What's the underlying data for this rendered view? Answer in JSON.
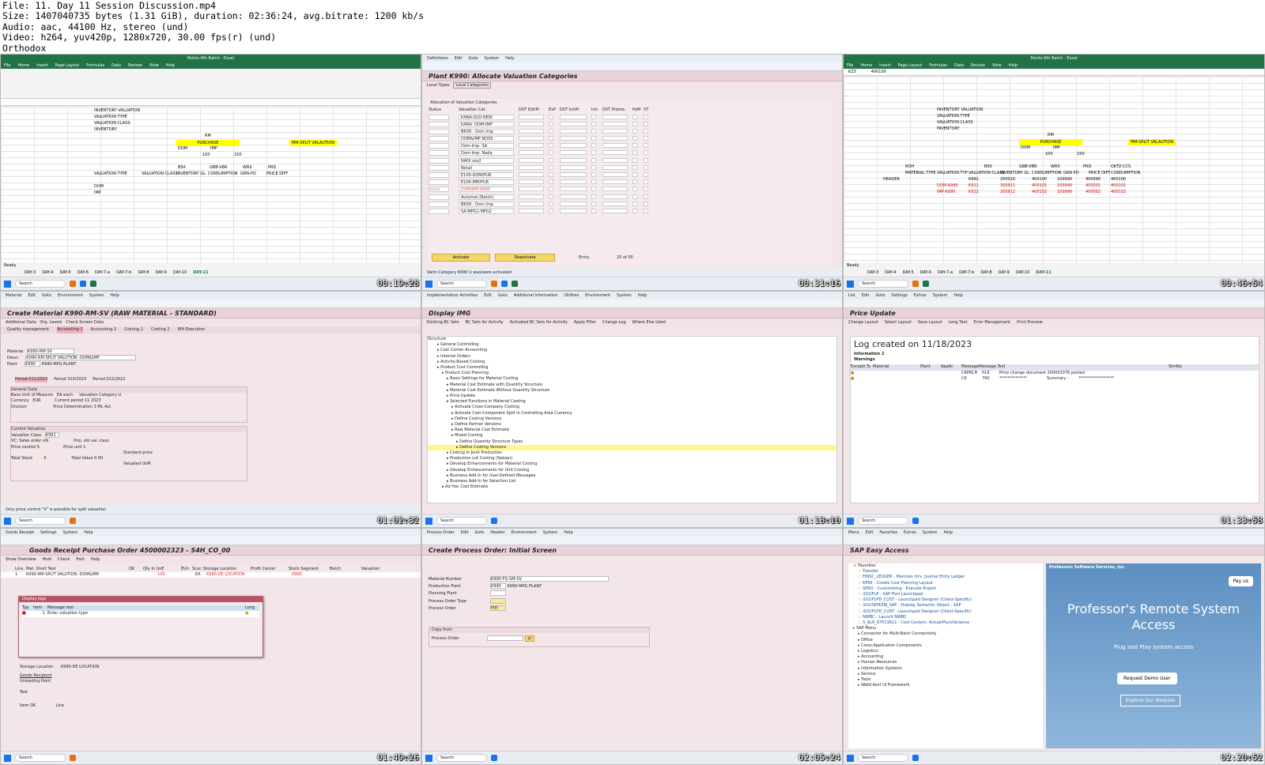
{
  "header": {
    "file": "File: 11. Day 11 Session Discussion.mp4",
    "size": "Size: 1407040735 bytes (1.31 GiB), duration: 02:36:24, avg.bitrate: 1200 kb/s",
    "audio": "Audio: aac, 44100 Hz, stereo (und)",
    "video": "Video: h264, yuv420p, 1280x720, 30.00 fps(r) (und)",
    "author": "Orthodox"
  },
  "frames": {
    "f1": {
      "ts": "00:19:28",
      "window_title": "Points-9th Batch - Excel",
      "tabs": [
        "File",
        "Home",
        "Insert",
        "Page Layout",
        "Formulas",
        "Data",
        "Review",
        "View",
        "Help"
      ],
      "labels": [
        "INVENTORY VALUATION",
        "VALUATION TYPE",
        "VALUATION CLASS",
        "INVENTORY",
        "RM",
        "PURCHASE",
        "MM-SPLIT VALAUTION",
        "DOM",
        "IMP",
        "100",
        "150",
        "BSX",
        "GBB-VBR",
        "WRX",
        "PRD",
        "VALUATION TYPE",
        "VALUATION CLASS",
        "INVENTORY GL",
        "CONSUMPTION",
        "GRN-PO",
        "PRICE DIFF",
        "DOM",
        "IMP"
      ],
      "sheets": [
        "DAY-3",
        "DAY-4",
        "DAY-5",
        "DAY-6",
        "DAY-7-a",
        "DAY-7-b",
        "DAY-8",
        "DAY-9",
        "DAY-10",
        "DAY-11"
      ]
    },
    "f2": {
      "ts": "00:31:16",
      "menu": [
        "Definitions",
        "Edit",
        "Goto",
        "System",
        "Help"
      ],
      "title": "Plant K990: Allocate Valuation Categories",
      "app": [
        "Local Types",
        "Local Categories"
      ],
      "section": "Allocation of Valuation Categories",
      "cols": [
        "Status",
        "Valuation Cat.",
        "DVT EditPr",
        "ExP",
        "DVT InhPr",
        "Inh",
        "DVT Promo.",
        "PoM",
        "VT"
      ],
      "rows": [
        "KANA-OLD-NEW",
        "KANA- DOM-IMP",
        "BK09 - Dom Imp",
        "DOM&IMP NOSS",
        "Dom-Imp- SA",
        "Dom-Imp- Nada",
        "NADI sce2",
        "Retail",
        "E100-DOM/PUR",
        "E100-IMP/PUR",
        "DOM/IMP-K990",
        "Automat.(Batch)",
        "BK09 - Dom Imp",
        "SA-MPG1-MPG2"
      ],
      "activate": "Activate",
      "deactivate": "Deactivate",
      "entry": "Entry",
      "entry_val": "25 of  50",
      "status": "Valtn Category K990 U was/were activated",
      "active": "Active"
    },
    "f3": {
      "ts": "00:46:54",
      "window_title": "Points-9th Batch - Excel",
      "namebox": "K23",
      "formula": "400100",
      "labels": [
        "INVENTORY VALUATION",
        "VALUATION TYPE",
        "VALUATION CLASS",
        "INVENTORY",
        "RM",
        "PURCHASE",
        "MM-SPLIT VALAUTION",
        "DOM",
        "IMP",
        "100",
        "150",
        "ROH",
        "BSX",
        "GBB-VBR",
        "WRX",
        "PRD",
        "OKTZ-CCS",
        "MATERIAL TYPE",
        "VALUATION TYP",
        "VALUATION CLASS",
        "INVENTORY GL",
        "CONSUMPTION",
        "GRN PO",
        "PRICE DIFF",
        "CONSUMPTION",
        "HEADER",
        "K991",
        "200010",
        "400100",
        "100990",
        "400990",
        "400100",
        "DOM-K990",
        "K911",
        "200911",
        "400101",
        "100990",
        "400001",
        "400101",
        "IMP-K990",
        "K912",
        "200912",
        "400102",
        "100990",
        "400002",
        "400102"
      ]
    },
    "f4": {
      "ts": "01:02:32",
      "title": "Create Material K990-RM-SV (RAW MATERIAL - STANDARD)",
      "app": [
        "Additional Data",
        "Org. Levels",
        "Check Screen Data"
      ],
      "tabs": [
        "Quality management",
        "Accounting 1",
        "Accounting 2",
        "Costing 1",
        "Costing 2",
        "WH Execution"
      ],
      "material": "K990-RM-SV",
      "desc": "K990-RM-SPLIT VALUTION -DOM&IMP",
      "plant": "K990",
      "plant_name": "K990-MPG PLANT",
      "period_tabs": [
        "Period 011/2023",
        "Period 010/2023",
        "Period 012/2022"
      ],
      "gd": "General Data",
      "cv": "Current Valuation",
      "fields": {
        "bum": "Base Unit of Measure",
        "bum_v": "EA",
        "bum_t": "each",
        "cur": "Currency",
        "cur_v": "EUR",
        "div": "Division",
        "vcat": "Valuation Category",
        "vcat_v": "U",
        "cp": "Current period",
        "cp_v": "11 2023",
        "pd": "Price Determination",
        "pd_v": "3",
        "ml": "ML Act.",
        "vc": "Valuation Class",
        "vc_v": "K991",
        "vcs": "VC: Sales order stk",
        "pc": "Price control",
        "pc_v": "S",
        "pp": "Proj. stk val. class",
        "pu": "Price unit",
        "pu_v": "1",
        "sp": "Standard price",
        "ts": "Total Stock",
        "ts_v": "0",
        "tv": "Total Value",
        "tv_v": "0.00",
        "vu": "Valuated UoM"
      },
      "status": "Only price control \"V\" is possible for split valuation"
    },
    "f5": {
      "ts": "01:18:10",
      "title": "Display IMG",
      "app": [
        "Existing BC Sets",
        "BC Sets for Activity",
        "Activated BC Sets for Activity",
        "Apply Filter",
        "Change Log",
        "Where Else Used"
      ],
      "structure": "Structure",
      "tree": [
        "General Controlling",
        "Cost Center Accounting",
        "Internal Orders",
        "Activity-Based Costing",
        "Product Cost Controlling",
        "Product Cost Planning",
        "Basic Settings for Material Costing",
        "Material Cost Estimate with Quantity Structure",
        "Material Cost Estimate Without Quantity Structure",
        "Price Update",
        "Selected Functions in Material Costing",
        "Activate Cross-Company Costing",
        "Activate Cost Component Split in Controlling Area Currency",
        "Define Costing Versions",
        "Define Partner Versions",
        "Raw Material Cost Estimate",
        "Mixed Costing",
        "Define Quantity Structure Types",
        "Define Costing Versions",
        "Costing in Joint Production",
        "Production Lot Costing (Sebian)",
        "Develop Enhancements for Material Costing",
        "Develop Enhancements for Unit Costing",
        "Business Add-In for User-Defined Messages",
        "Business Add-In for Selection List",
        "Ad Hoc Cost Estimate"
      ]
    },
    "f6": {
      "ts": "01:33:58",
      "title": "Price Update",
      "app": [
        "Change Layout",
        "Select Layout",
        "Save Layout",
        "Long Text",
        "Error Management",
        "Print Preview"
      ],
      "log": "Log created on 11/18/2023",
      "info": "Information",
      "info_n": "2",
      "warn": "Warnings",
      "cols": [
        "Excepti.",
        "Ty",
        "Material",
        "Plant",
        "AppAr.",
        "Message",
        "Message Text",
        "StmNo"
      ],
      "r1": [
        "CKPRCH",
        "019",
        "Price change document 200001076 posted"
      ],
      "r2": [
        "CK",
        "790",
        "**************",
        "Summary :",
        "******************"
      ]
    },
    "f7": {
      "ts": "01:49:26",
      "title": "Goods Receipt Purchase Order 4500002323 - S4H_CO_00",
      "menu": [
        "Goods Receipt",
        "Settings",
        "System",
        "Help"
      ],
      "app": [
        "Show Overview",
        "Hold",
        "Check",
        "Post",
        "Help"
      ],
      "cols": [
        "Line",
        "Mat. Short Text",
        "OK",
        "Qty in UnE",
        "EUn",
        "SLoc",
        "Storage Location",
        "Profit Center",
        "Stock Segment",
        "Batch",
        "Valuation"
      ],
      "row": [
        "1",
        "K990-RM-SPLIT VALUTION -DOM&IMP",
        "100",
        "EA",
        "K990-DE LOCATION",
        "K990"
      ],
      "dlg": "Display logs",
      "dlg_cols": [
        "Typ",
        "Item",
        "Message text",
        "Long"
      ],
      "dlg_row": [
        "1",
        "Enter valuation type"
      ],
      "fields": [
        "Goods Recipient",
        "Unloading Point",
        "Text",
        "Storage Location",
        "K990-DE LOCATION",
        "Item OK",
        "Line"
      ]
    },
    "f8": {
      "ts": "02:05:24",
      "title": "Create Process Order: Initial Screen",
      "menu": [
        "Process Order",
        "Edit",
        "Goto",
        "Header",
        "Environment",
        "System",
        "Help"
      ],
      "f": [
        "Material Number",
        "Production Plant",
        "Planning Plant",
        "Process Order Type",
        "Process Order"
      ],
      "v": [
        "K990-FG-SM-SV",
        "K990",
        "K990-MPG PLANT",
        "",
        "FIPI"
      ],
      "copy": "Copy from",
      "po": "Process Order"
    },
    "f9": {
      "ts": "02:20:52",
      "title": "SAP Easy Access",
      "menu": [
        "Menu",
        "Edit",
        "Favorites",
        "Extras",
        "System",
        "Help"
      ],
      "tree": [
        "Favorites",
        "Transfer",
        "FINSC_LEDGER - Maintain Unv. Journal Entry Ledger",
        "KP65 - Create Cost Planning Layout",
        "SPRO - Customizing - Execute Project",
        "/UI2/FLP - SAP Fiori Launchpad",
        "/UI2/FLPD_CUST - Launchpad Designer (Client-Specific)",
        "/UI2/SEMOBJ_SAP - Display Semantic Object - SAP",
        "/UI2/FLPD_CUST - Launchpad Designer (Client-Specific)",
        "NWBC - Launch NWBC",
        "S_ALR_87013611 - Cost Centers: Actual/Plan/Variance",
        "SAP Menu",
        "Connector for Multi-Bank Connectivity",
        "Office",
        "Cross-Application Components",
        "Logistics",
        "Accounting",
        "Human Resources",
        "Information Systems",
        "Service",
        "Tools",
        "WebClient UI Framework"
      ],
      "company": "Professors Software Services, Inc.",
      "pay": "Pay us",
      "hero": "Professor's Remote System Access",
      "sub": "Plug and Play system access",
      "demo": "Request Demo User",
      "explore": "Explore Our Modules"
    }
  },
  "taskbar": {
    "search": "Search",
    "lang": "ENG IN",
    "weather": "26°C",
    "weather2": "Partly sunny"
  },
  "colors": {
    "excel": "#217346",
    "sap_bg": "#f2e6e9",
    "yellow": "#ffff00"
  }
}
